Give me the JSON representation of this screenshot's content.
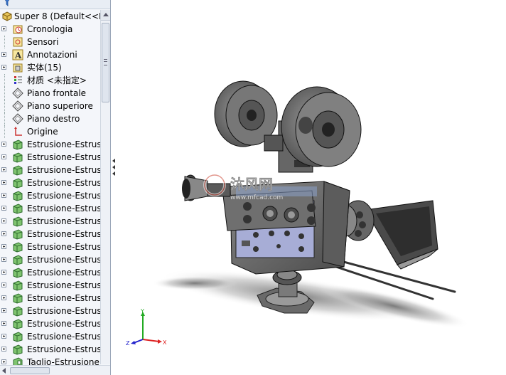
{
  "tree": {
    "root": {
      "label": "Super 8  (Default<<D",
      "icon": "part-icon"
    },
    "items": [
      {
        "label": "Cronologia",
        "icon": "history-icon",
        "expandable": true
      },
      {
        "label": "Sensori",
        "icon": "sensor-icon",
        "expandable": false
      },
      {
        "label": "Annotazioni",
        "icon": "annotation-icon",
        "expandable": true
      },
      {
        "label": "实体(15)",
        "icon": "solid-bodies-icon",
        "expandable": true
      },
      {
        "label": "材质 <未指定>",
        "icon": "material-icon",
        "expandable": false
      },
      {
        "label": "Piano frontale",
        "icon": "plane-icon",
        "expandable": false
      },
      {
        "label": "Piano superiore",
        "icon": "plane-icon",
        "expandable": false
      },
      {
        "label": "Piano destro",
        "icon": "plane-icon",
        "expandable": false
      },
      {
        "label": "Origine",
        "icon": "origin-icon",
        "expandable": false
      },
      {
        "label": "Estrusione-Estrusi",
        "icon": "extrude-icon",
        "expandable": true
      },
      {
        "label": "Estrusione-Estrusi",
        "icon": "extrude-icon",
        "expandable": true
      },
      {
        "label": "Estrusione-Estrusi",
        "icon": "extrude-icon",
        "expandable": true
      },
      {
        "label": "Estrusione-Estrusi",
        "icon": "extrude-icon",
        "expandable": true
      },
      {
        "label": "Estrusione-Estrusi",
        "icon": "extrude-icon",
        "expandable": true
      },
      {
        "label": "Estrusione-Estrusi",
        "icon": "extrude-icon",
        "expandable": true
      },
      {
        "label": "Estrusione-Estrusi",
        "icon": "extrude-icon",
        "expandable": true
      },
      {
        "label": "Estrusione-Estrusi",
        "icon": "extrude-icon",
        "expandable": true
      },
      {
        "label": "Estrusione-Estrusi",
        "icon": "extrude-icon",
        "expandable": true
      },
      {
        "label": "Estrusione-Estrusi",
        "icon": "extrude-icon",
        "expandable": true
      },
      {
        "label": "Estrusione-Estrusi",
        "icon": "extrude-icon",
        "expandable": true
      },
      {
        "label": "Estrusione-Estrusi",
        "icon": "extrude-icon",
        "expandable": true
      },
      {
        "label": "Estrusione-Estrusi",
        "icon": "extrude-icon",
        "expandable": true
      },
      {
        "label": "Estrusione-Estrusi",
        "icon": "extrude-icon",
        "expandable": true
      },
      {
        "label": "Estrusione-Estrusi",
        "icon": "extrude-icon",
        "expandable": true
      },
      {
        "label": "Estrusione-Estrusi",
        "icon": "extrude-icon",
        "expandable": true
      },
      {
        "label": "Estrusione-Estrusi",
        "icon": "extrude-icon",
        "expandable": true
      },
      {
        "label": "Taglio-Estrusione",
        "icon": "cut-extrude-icon",
        "expandable": true
      }
    ]
  },
  "watermark": {
    "brand": "沐风网",
    "url": "www.mfcad.com"
  },
  "triad": {
    "x": "X",
    "y": "Y",
    "z": "Z"
  },
  "colors": {
    "panel_bg": "#f4f6fa",
    "extrude_icon": "#3f9a3f",
    "model_gray": "#6f6f6f",
    "panel_blue": "#9ea6d2",
    "triad_x": "#d22",
    "triad_y": "#2a2",
    "triad_z": "#22c"
  }
}
